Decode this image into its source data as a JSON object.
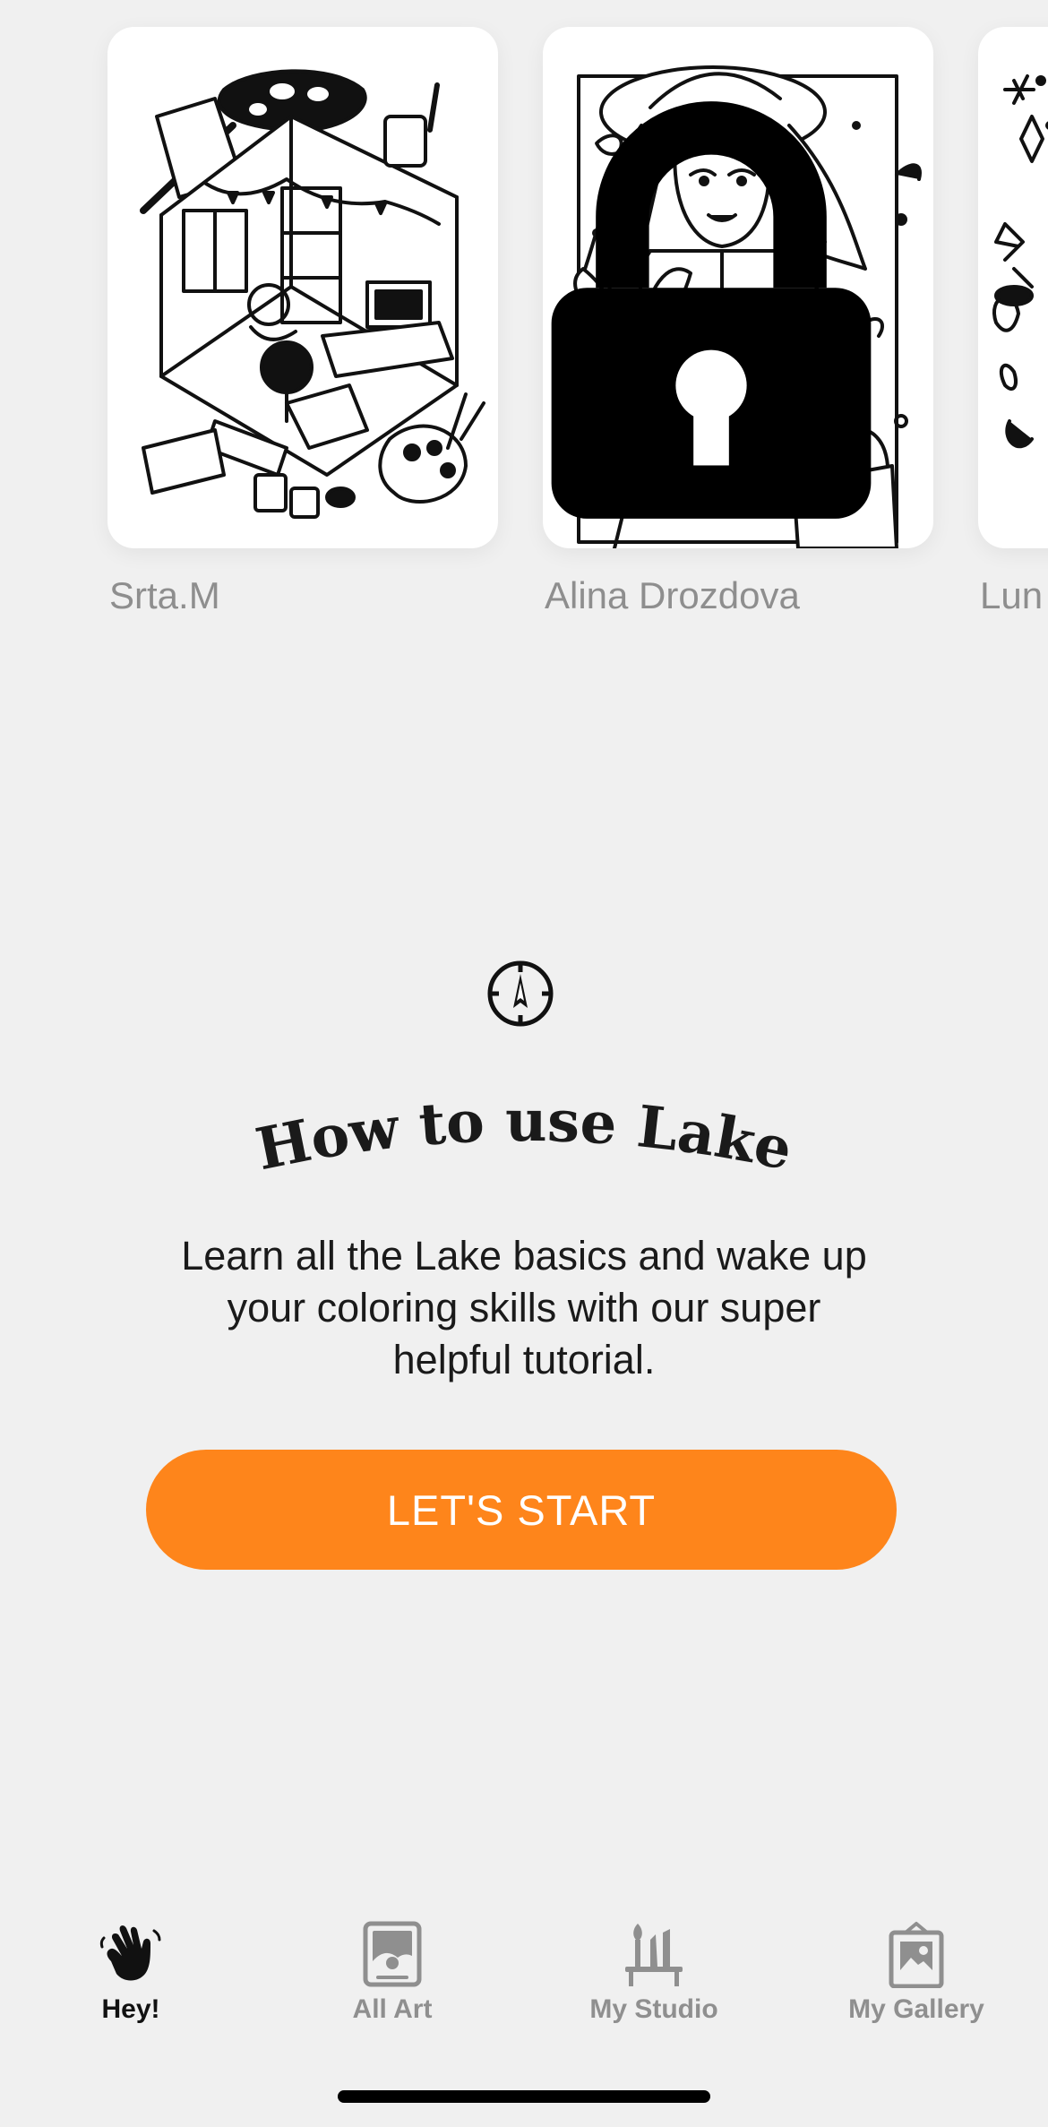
{
  "featured": {
    "cards": [
      {
        "artist": "Srta.M",
        "illustration_icon": "artist-studio-room-illustration",
        "locked": false
      },
      {
        "artist": "Alina Drozdova",
        "illustration_icon": "woman-holding-plant-illustration",
        "locked": true
      },
      {
        "artist": "Lun",
        "illustration_icon": "doodle-flowers-illustration",
        "locked": false
      }
    ],
    "lock_icon": "lock-icon"
  },
  "tutorial": {
    "icon": "compass-icon",
    "title": "How to use Lake",
    "description": "Learn all the Lake basics and wake up your coloring skills with our super helpful tutorial.",
    "button_label": "LET'S START"
  },
  "tab_bar": {
    "items": [
      {
        "label": "Hey!",
        "icon": "waving-hand-icon",
        "active": true
      },
      {
        "label": "All Art",
        "icon": "picture-frame-icon",
        "active": false
      },
      {
        "label": "My Studio",
        "icon": "brushes-icon",
        "active": false
      },
      {
        "label": "My Gallery",
        "icon": "gallery-easel-icon",
        "active": false
      }
    ]
  },
  "colors": {
    "background": "#f0f0f0",
    "accent": "#fe851b",
    "active_tab": "#111111",
    "inactive_tab": "#8f8f8f",
    "artist_label": "#8e8e8e"
  }
}
